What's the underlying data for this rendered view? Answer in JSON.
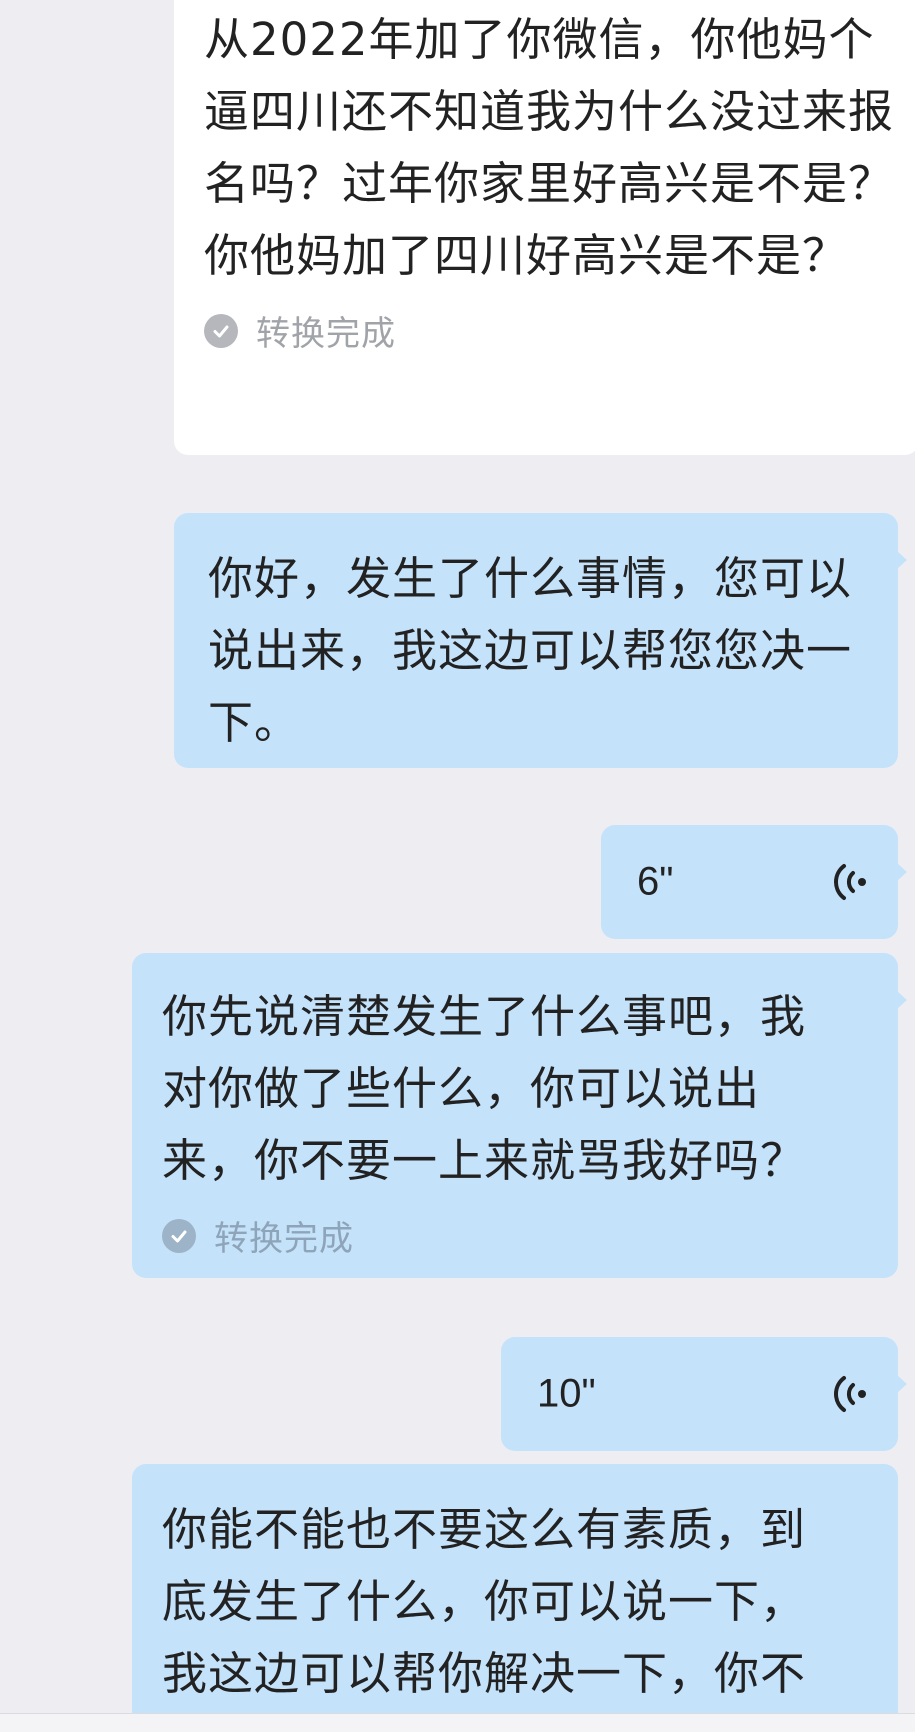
{
  "messages": [
    {
      "type": "incoming-text",
      "text": "从2022年加了你微信，你他妈个逼四川还不知道我为什么没过来报名吗？过年你家里好高兴是不是？你他妈加了四川好高兴是不是？",
      "status": "转换完成"
    },
    {
      "type": "outgoing-text",
      "text": "你好，发生了什么事情，您可以说出来，我这边可以帮您您决一下。"
    },
    {
      "type": "outgoing-voice",
      "duration": "6\""
    },
    {
      "type": "outgoing-text",
      "text": "你先说清楚发生了什么事吧，我对你做了些什么，你可以说出来，你不要一上来就骂我好吗？",
      "status": "转换完成"
    },
    {
      "type": "outgoing-voice",
      "duration": "10\""
    },
    {
      "type": "outgoing-text",
      "text": "你能不能也不要这么有素质，到底发生了什么，你可以说一下，我这边可以帮你解决一下，你不"
    }
  ],
  "icons": {
    "check": "check-circle-icon",
    "voice": "voice-wave-icon"
  },
  "colors": {
    "background": "#eeeef2",
    "incoming_bubble": "#ffffff",
    "outgoing_bubble": "#c5e2fb",
    "status_text": "#a0a3a8"
  }
}
